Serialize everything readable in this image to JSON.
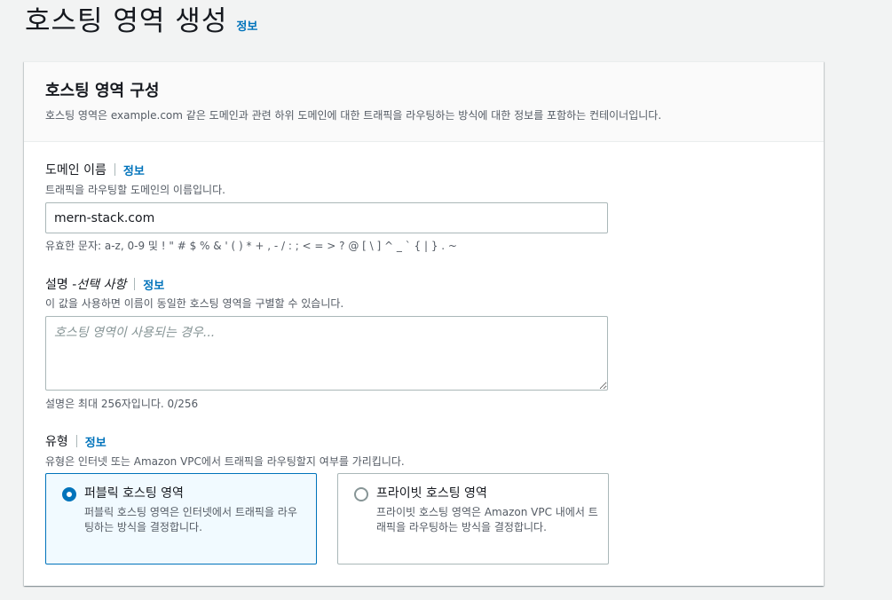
{
  "page": {
    "title": "호스팅 영역 생성",
    "info": "정보"
  },
  "panel": {
    "title": "호스팅 영역 구성",
    "description": "호스팅 영역은 example.com 같은 도메인과 관련 하위 도메인에 대한 트래픽을 라우팅하는 방식에 대한 정보를 포함하는 컨테이너입니다."
  },
  "domain": {
    "label": "도메인 이름",
    "info": "정보",
    "description": "트래픽을 라우팅할 도메인의 이름입니다.",
    "value": "mern-stack.com",
    "constraint": "유효한 문자: a-z, 0-9 및 ! \" # $ % & ' ( ) * + , - / : ; < = > ? @ [ \\ ] ^ _ ` { | } . ~"
  },
  "description_field": {
    "label": "설명 - ",
    "optional": "선택 사항",
    "info": "정보",
    "description": "이 값을 사용하면 이름이 동일한 호스팅 영역을 구별할 수 있습니다.",
    "placeholder": "호스팅 영역이 사용되는 경우...",
    "value": "",
    "constraint": "설명은 최대 256자입니다. 0/256"
  },
  "type": {
    "label": "유형",
    "info": "정보",
    "description": "유형은 인터넷 또는 Amazon VPC에서 트래픽을 라우팅할지 여부를 가리킵니다.",
    "selected": "public",
    "options": [
      {
        "title": "퍼블릭 호스팅 영역",
        "description": "퍼블릭 호스팅 영역은 인터넷에서 트래픽을 라우팅하는 방식을 결정합니다."
      },
      {
        "title": "프라이빗 호스팅 영역",
        "description": "프라이빗 호스팅 영역은 Amazon VPC 내에서 트래픽을 라우팅하는 방식을 결정합니다."
      }
    ]
  },
  "colors": {
    "link": "#0073bb",
    "selected_tile_bg": "#f1faff",
    "border": "#aab7b8"
  }
}
